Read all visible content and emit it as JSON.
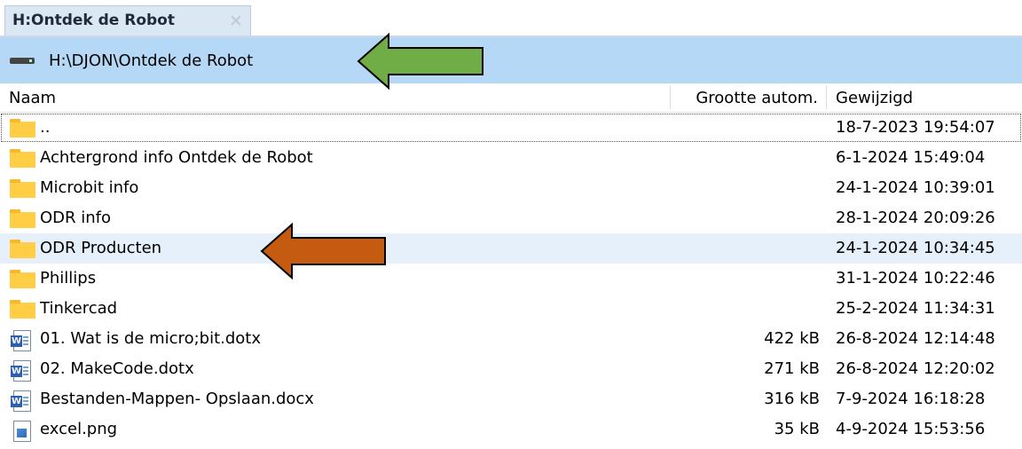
{
  "tab": {
    "title": "H:Ontdek de Robot",
    "close_glyph": "✕"
  },
  "path": {
    "text": "H:\\DJON\\Ontdek de Robot",
    "icon": "drive-icon"
  },
  "columns": {
    "name": "Naam",
    "size": "Grootte autom.",
    "modified": "Gewijzigd"
  },
  "rows": [
    {
      "icon": "folder-icon",
      "name": "..",
      "size": "",
      "modified": "18-7-2023 19:54:07"
    },
    {
      "icon": "folder-icon",
      "name": "Achtergrond info Ontdek de Robot",
      "size": "",
      "modified": "6-1-2024 15:49:04"
    },
    {
      "icon": "folder-icon",
      "name": "Microbit info",
      "size": "",
      "modified": "24-1-2024 10:39:01"
    },
    {
      "icon": "folder-icon",
      "name": "ODR info",
      "size": "",
      "modified": "28-1-2024 20:09:26"
    },
    {
      "icon": "folder-icon",
      "name": "ODR Producten",
      "size": "",
      "modified": "24-1-2024 10:34:45"
    },
    {
      "icon": "folder-icon",
      "name": "Phillips",
      "size": "",
      "modified": "31-1-2024 10:22:46"
    },
    {
      "icon": "folder-icon",
      "name": "Tinkercad",
      "size": "",
      "modified": "25-2-2024 11:34:31"
    },
    {
      "icon": "word-template-icon",
      "name": "01. Wat is de micro;bit.dotx",
      "size": "422 kB",
      "modified": "26-8-2024 12:14:48"
    },
    {
      "icon": "word-template-icon",
      "name": "02. MakeCode.dotx",
      "size": "271 kB",
      "modified": "26-8-2024 12:20:02"
    },
    {
      "icon": "word-document-icon",
      "name": "Bestanden-Mappen- Opslaan.docx",
      "size": "316 kB",
      "modified": "7-9-2024 16:18:28"
    },
    {
      "icon": "image-file-icon",
      "name": "excel.png",
      "size": "35 kB",
      "modified": "4-9-2024 15:53:56"
    }
  ],
  "colors": {
    "path_bar": "#b5d8f7",
    "tab_bg": "#dbe7f3",
    "selected_row": "#e5f0fb",
    "green_arrow": "#70ad47",
    "orange_arrow": "#c55a11"
  },
  "annotations": [
    {
      "icon": "green-arrow-icon",
      "points_to": "path-bar"
    },
    {
      "icon": "orange-arrow-icon",
      "points_to": "row-odr-producten"
    }
  ]
}
